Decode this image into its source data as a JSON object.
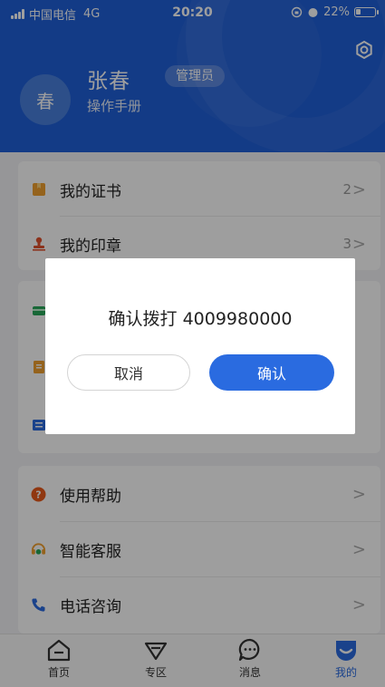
{
  "status_bar": {
    "carrier": "中国电信",
    "network": "4G",
    "time": "20:20",
    "battery": "22%"
  },
  "profile": {
    "avatar_text": "春",
    "name": "张春",
    "role_badge": "管理员",
    "subtitle": "操作手册"
  },
  "card1": [
    {
      "label": "我的证书",
      "count": "2",
      "chevron": ">",
      "icon": "certificate-icon"
    },
    {
      "label": "我的印章",
      "count": "3",
      "chevron": ">",
      "icon": "seal-icon"
    }
  ],
  "card2_chevrons": [],
  "card3": [
    {
      "label": "使用帮助",
      "chevron": ">",
      "icon": "help-icon"
    },
    {
      "label": "智能客服",
      "chevron": ">",
      "icon": "customer-service-icon"
    },
    {
      "label": "电话咨询",
      "chevron": ">",
      "icon": "phone-icon"
    }
  ],
  "tabs": [
    {
      "label": "首页",
      "icon": "home-icon"
    },
    {
      "label": "专区",
      "icon": "zone-icon"
    },
    {
      "label": "消息",
      "icon": "message-icon"
    },
    {
      "label": "我的",
      "icon": "profile-icon",
      "active": true
    }
  ],
  "dialog": {
    "message": "确认拨打 4009980000",
    "cancel_label": "取消",
    "confirm_label": "确认"
  },
  "colors": {
    "header_blue": "#1f5fd8",
    "accent_blue": "#2a6be0",
    "certificate_orange": "#f0a030",
    "seal_red": "#e0522e",
    "card_green": "#27a85a",
    "help_orange": "#e95a1a",
    "phone_blue": "#2a6be0"
  }
}
